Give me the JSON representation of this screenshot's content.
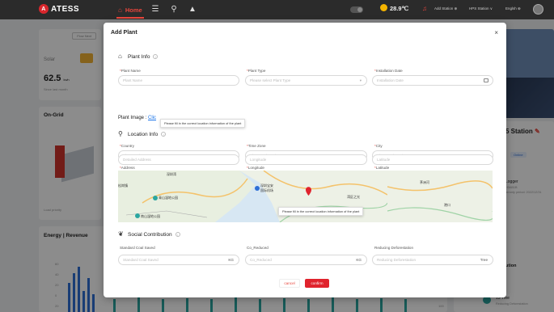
{
  "brand": {
    "name": "ATESS",
    "logo_letter": "A"
  },
  "nav": {
    "home": "Home"
  },
  "topbar": {
    "weather": "28.9℃",
    "add_station": "Add Station ⊕",
    "station_menu": "HPS Station ∨",
    "language": "Englsh ⊕"
  },
  "dashboard": {
    "solar_label": "Solar",
    "solar_value": "62.5",
    "solar_unit": "kwh",
    "solar_sub": "Since last month",
    "flow_next": "Flow Next",
    "on_grid": "On-Grid",
    "load_priority": "Load priority",
    "energy_revenue": "Energy | Revenue",
    "y_ticks": [
      "60",
      "40",
      "20",
      "0",
      "20"
    ],
    "right_y_tick": "100",
    "station_title": "5 Station",
    "station_status": "Online",
    "logger": "Logger",
    "module_code": "H0AB1B",
    "warranty": "arranty period: 2022/12/31",
    "contribution": "ution",
    "tree_count": "13 Tree",
    "tree_label": "Reducing Deforestation"
  },
  "modal": {
    "title": "Add Plant",
    "close": "×",
    "plant_info": {
      "title": "Plant Info",
      "plant_name_label": "Plant Name",
      "plant_name_placeholder": "Plant Name",
      "plant_type_label": "Plant Type",
      "plant_type_placeholder": "Please select Plant Type",
      "install_date_label": "Installation Date",
      "install_date_placeholder": "Installation Date"
    },
    "plant_image": {
      "label": "Plant Image :",
      "link": "Clic"
    },
    "tooltip": "Please fill in the correct location information of the plant",
    "location_info": {
      "title": "Location Info",
      "country_label": "Country",
      "country_placeholder": "Please select country",
      "timezone_label": "Time Zone",
      "timezone_placeholder": "Please select Time Zone",
      "city_label": "City",
      "city_placeholder": "Please select Time Zone",
      "address_label": "Address",
      "address_placeholder": "Detailed Address",
      "longitude_label": "Longitude",
      "longitude_placeholder": "Longitude",
      "latitude_label": "Latitude",
      "latitude_placeholder": "Latitude"
    },
    "map": {
      "labels": [
        "深圳湾",
        "青山湿地公园",
        "南山湿地公园",
        "深圳宝安",
        "国际机场",
        "深圳机场",
        "湾区之光",
        "茅洲河",
        "珠江口",
        "新会区",
        "松岗镇",
        "港口"
      ],
      "tooltip": "Please fill in the correct location information of the plant"
    },
    "social": {
      "title": "Social Contribution",
      "coal_label": "Standard Coal Saved",
      "coal_placeholder": "Standard Coal Saved",
      "coal_unit": "KG",
      "co2_label": "Co_Reduced",
      "co2_placeholder": "Co_Reduced",
      "co2_unit": "KG",
      "defor_label": "Reducing Deforestation",
      "defor_placeholder": "Reducing Deforestation",
      "defor_unit": "Tree"
    },
    "buttons": {
      "cancel": "cancel",
      "confirm": "confirm"
    }
  },
  "colors": {
    "accent": "#e0232d",
    "link": "#1a73e8",
    "topbar": "#2b2b2b"
  }
}
